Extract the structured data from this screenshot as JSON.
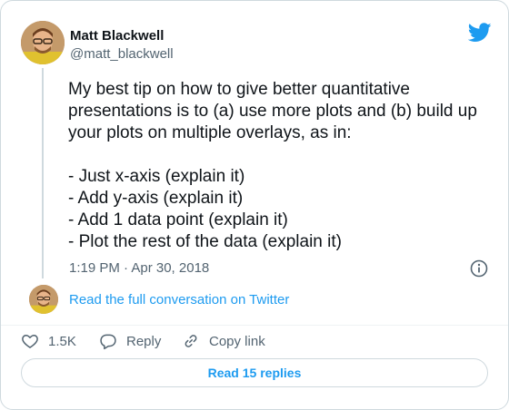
{
  "author": {
    "display_name": "Matt Blackwell",
    "handle": "@matt_blackwell"
  },
  "tweet": {
    "text": "My best tip on how to give better quantitative presentations is to (a) use more plots and (b) build up your plots on multiple overlays, as in:\n\n- Just x-axis (explain it)\n- Add y-axis (explain it)\n- Add 1 data point (explain it)\n- Plot the rest of the data (explain it)",
    "timestamp": "1:19 PM · Apr 30, 2018"
  },
  "conversation_link": "Read the full conversation on Twitter",
  "actions": {
    "like_count": "1.5K",
    "reply_label": "Reply",
    "copy_label": "Copy link"
  },
  "replies_button": "Read 15 replies",
  "colors": {
    "accent": "#1d9bf0",
    "text_primary": "#0f1419",
    "text_secondary": "#536471",
    "border": "#cfd9de"
  },
  "icons": {
    "brand": "twitter-bird-icon",
    "info": "info-icon",
    "like": "heart-icon",
    "reply": "speech-bubble-icon",
    "copy": "link-icon"
  }
}
